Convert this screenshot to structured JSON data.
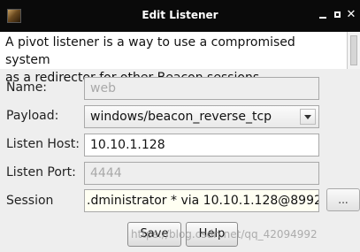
{
  "window": {
    "title": "Edit Listener"
  },
  "description": {
    "line1": "A pivot listener is a way to use a compromised system",
    "line2": "as a redirector for other Beacon sessions."
  },
  "form": {
    "name": {
      "label": "Name:",
      "value": "web"
    },
    "payload": {
      "label": "Payload:",
      "value": "windows/beacon_reverse_tcp"
    },
    "listen_host": {
      "label": "Listen Host:",
      "value": "10.10.1.128"
    },
    "listen_port": {
      "label": "Listen Port:",
      "value": "4444"
    },
    "session": {
      "label": "Session",
      "value": ".dministrator * via  10.10.1.128@8992",
      "browse_label": "..."
    }
  },
  "buttons": {
    "save": "Save",
    "help": "Help"
  },
  "watermark": "https://blog.csdn.net/qq_42094992",
  "icons": {
    "app": "cobalt-strike-app-icon",
    "minimize": "minimize-icon",
    "maximize": "maximize-icon",
    "close": "close-icon",
    "dropdown": "chevron-down-icon"
  },
  "colors": {
    "titlebar": "#0a0a0a",
    "disabled_text": "#a9a9a9",
    "session_bg": "#fffff2"
  }
}
